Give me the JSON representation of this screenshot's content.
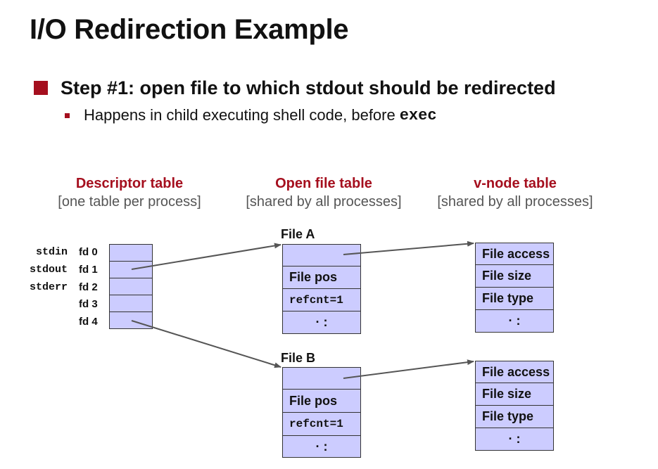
{
  "slide": {
    "title": "I/O Redirection Example",
    "bullet_main": "Step #1: open file to which stdout should be redirected",
    "bullet_sub_text": "Happens in child executing shell code, before",
    "bullet_sub_code": "exec"
  },
  "colors": {
    "accent_red": "#a50f1e",
    "cell_fill": "#ccccff",
    "subtitle_gray": "#555555"
  },
  "headers": {
    "descriptor": {
      "title": "Descriptor table",
      "subtitle": "[one table per process]"
    },
    "open_file": {
      "title": "Open file table",
      "subtitle": "[shared by all processes]"
    },
    "vnode": {
      "title": "v-node table",
      "subtitle": "[shared by all processes]"
    }
  },
  "descriptor_table": {
    "streams": [
      "stdin",
      "stdout",
      "stderr"
    ],
    "fds": [
      "fd 0",
      "fd 1",
      "fd 2",
      "fd 3",
      "fd 4"
    ]
  },
  "file_a": {
    "label": "File A",
    "pos": "File pos",
    "refcnt": "refcnt=1",
    "dots": "· :"
  },
  "file_b": {
    "label": "File B",
    "pos": "File pos",
    "refcnt": "refcnt=1",
    "dots": "· :"
  },
  "vnode_a": {
    "access": "File access",
    "size": "File size",
    "type": "File type",
    "dots": "· :"
  },
  "vnode_b": {
    "access": "File access",
    "size": "File size",
    "type": "File type",
    "dots": "· :"
  },
  "icons": {
    "main_bullet": "square-bullet-icon",
    "sub_bullet": "small-square-bullet-icon"
  }
}
